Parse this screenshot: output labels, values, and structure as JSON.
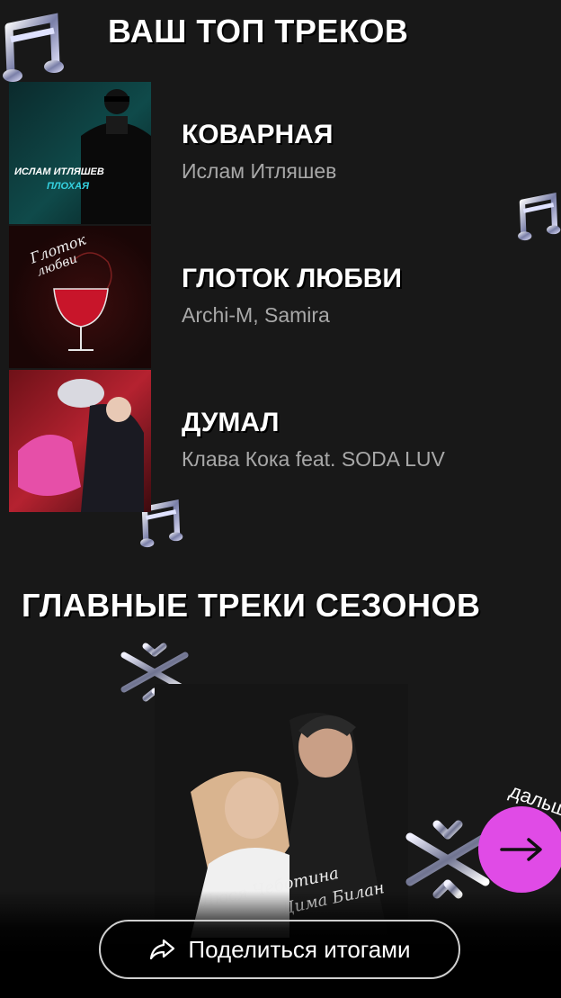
{
  "top_tracks": {
    "title": "ВАШ ТОП ТРЕКОВ",
    "items": [
      {
        "name": "КОВАРНАЯ",
        "artist": "Ислам Итляшев",
        "cover_text": [
          "ИСЛАМ ИТЛЯШЕВ",
          "ПЛОХАЯ"
        ]
      },
      {
        "name": "ГЛОТОК ЛЮБВИ",
        "artist": "Archi-M, Samira",
        "cover_text": [
          "Глоток",
          "любви"
        ]
      },
      {
        "name": "ДУМАЛ",
        "artist": "Клава Кока feat. SODA LUV",
        "cover_text": []
      }
    ]
  },
  "season_tracks": {
    "title": "ГЛАВНЫЕ ТРЕКИ СЕЗОНОВ",
    "cover_text": [
      "Люся Чеботина",
      "Дима Билан"
    ]
  },
  "next": {
    "label": "дальше"
  },
  "share": {
    "label": "Поделиться итогами",
    "icon": "share-icon"
  },
  "colors": {
    "background": "#181818",
    "accent": "#e04be6",
    "secondary_text": "#a8a8a8"
  }
}
